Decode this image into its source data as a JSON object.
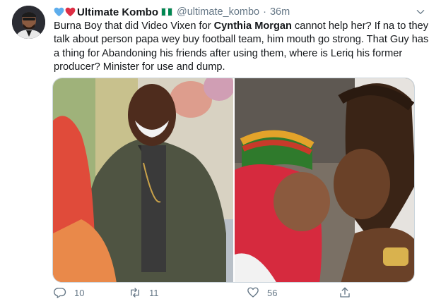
{
  "tweet": {
    "author_name": "Ultimate Kombo",
    "handle": "@ultimate_kombo",
    "separator": "·",
    "time": "36m",
    "text_part1": "Burna Boy that did Video Vixen for ",
    "mention": "Cynthia Morgan",
    "text_part2": " cannot help her? If na to they talk about person papa wey buy football team, him mouth go strong. That Guy has a thing for Abandoning his friends after using them, where is Leriq his former producer? Minister for use and dump.",
    "decor_icons": [
      "blue-heart-icon",
      "red-heart-icon",
      "nigeria-flag-icon"
    ],
    "colors": {
      "blue_heart": "#5dadec",
      "red_heart": "#dd2e44",
      "flag_green": "#008751",
      "muted_text": "#657786"
    }
  },
  "actions": {
    "reply_count": "10",
    "retweet_count": "11",
    "like_count": "56"
  }
}
